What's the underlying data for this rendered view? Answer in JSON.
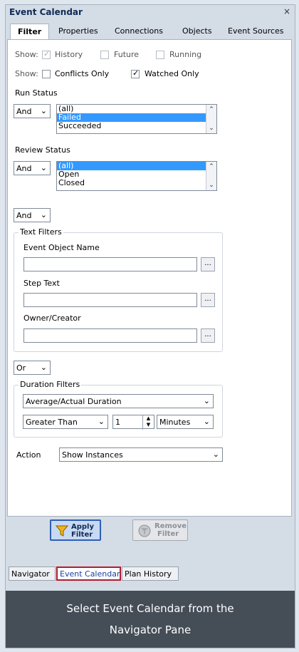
{
  "window": {
    "title": "Event Calendar",
    "close_glyph": "×"
  },
  "tabs": [
    "Filter",
    "Properties",
    "Connections",
    "Objects",
    "Event Sources"
  ],
  "show_row1": {
    "label": "Show:",
    "options": [
      {
        "label": "History",
        "checked": true,
        "disabled": true
      },
      {
        "label": "Future",
        "checked": false,
        "disabled": true
      },
      {
        "label": "Running",
        "checked": false,
        "disabled": true
      }
    ]
  },
  "show_row2": {
    "label": "Show:",
    "options": [
      {
        "label": "Conflicts Only",
        "checked": false
      },
      {
        "label": "Watched Only",
        "checked": true
      }
    ]
  },
  "run_status": {
    "label": "Run Status",
    "operator": "And",
    "items": [
      "(all)",
      "Failed",
      "Succeeded"
    ],
    "selected": 1
  },
  "review_status": {
    "label": "Review Status",
    "operator": "And",
    "items": [
      "(all)",
      "Open",
      "Closed"
    ],
    "selected": 0
  },
  "connector1": "And",
  "text_filters": {
    "title": "Text Filters",
    "fields": [
      {
        "label": "Event Object Name",
        "value": "",
        "browse": "..."
      },
      {
        "label": "Step Text",
        "value": "",
        "browse": "..."
      },
      {
        "label": "Owner/Creator",
        "value": "",
        "browse": "..."
      }
    ]
  },
  "connector2": "Or",
  "duration_filters": {
    "title": "Duration Filters",
    "measure": "Average/Actual Duration",
    "comparison": "Greater Than",
    "amount": "1",
    "unit": "Minutes"
  },
  "action": {
    "label": "Action",
    "value": "Show Instances"
  },
  "buttons": {
    "apply": {
      "line1": "Apply",
      "line2": "Filter"
    },
    "remove": {
      "line1": "Remove",
      "line2": "Filter"
    }
  },
  "bottom_tabs": [
    "Navigator",
    "Event Calendar",
    "Plan History"
  ],
  "caption": {
    "line1": "Select Event Calendar from the",
    "line2": "Navigator Pane"
  },
  "colors": {
    "selection": "#3399ff",
    "active_tab_border": "#b31b2f",
    "caption_bg": "#454d57"
  }
}
